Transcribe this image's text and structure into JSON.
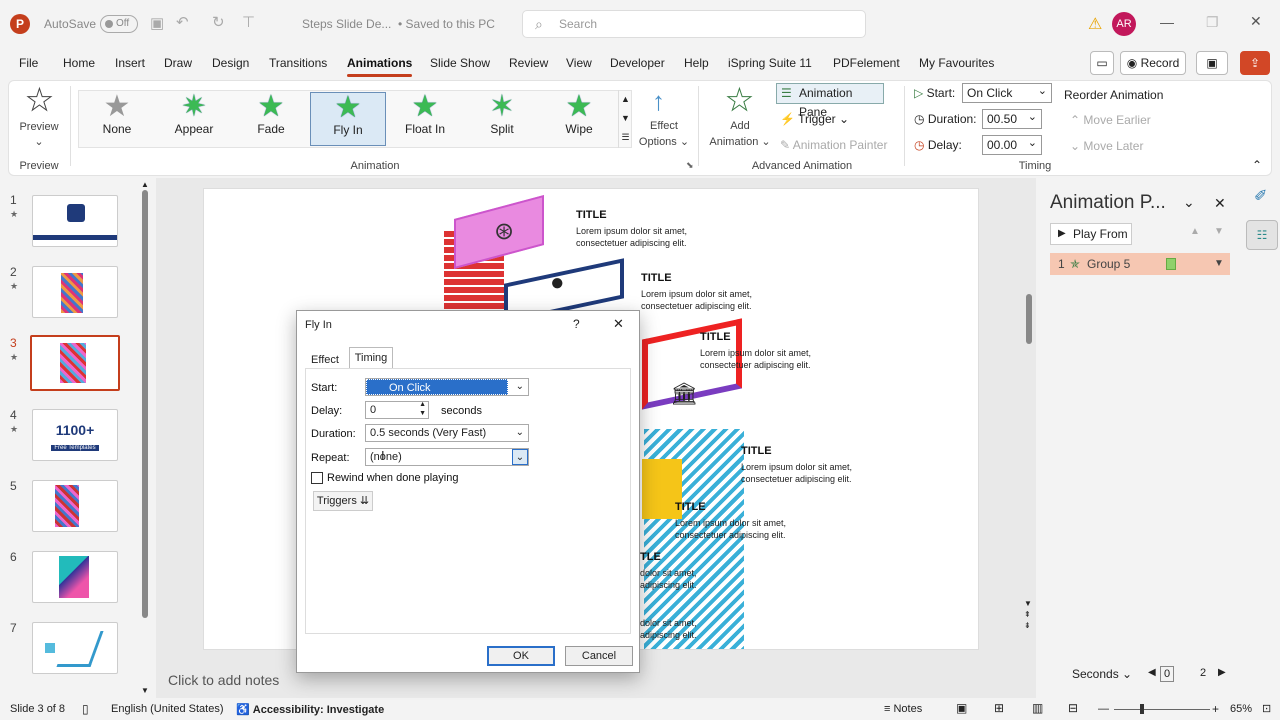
{
  "titlebar": {
    "autosave": "AutoSave",
    "toggle": "Off",
    "doc": "Steps Slide De...",
    "saved": "Saved to this PC",
    "search": "Search",
    "user": "AR"
  },
  "menu": [
    "File",
    "Home",
    "Insert",
    "Draw",
    "Design",
    "Transitions",
    "Animations",
    "Slide Show",
    "Review",
    "View",
    "Developer",
    "Help",
    "iSpring Suite 11",
    "PDFelement",
    "My Favourites"
  ],
  "record": "Record",
  "ribbon": {
    "preview": "Preview",
    "preview_group": "Preview",
    "gallery": [
      "None",
      "Appear",
      "Fade",
      "Fly In",
      "Float In",
      "Split",
      "Wipe"
    ],
    "animation_group": "Animation",
    "effect_options": "Effect",
    "effect_options2": "Options",
    "add_animation": "Add",
    "add_animation2": "Animation",
    "animation_pane": "Animation Pane",
    "trigger": "Trigger",
    "animation_painter": "Animation Painter",
    "advanced_group": "Advanced Animation",
    "start_label": "Start:",
    "start_value": "On Click",
    "duration_label": "Duration:",
    "duration_value": "00.50",
    "delay_label": "Delay:",
    "delay_value": "00.00",
    "reorder": "Reorder Animation",
    "move_earlier": "Move Earlier",
    "move_later": "Move Later",
    "timing_group": "Timing"
  },
  "slides": [
    "1",
    "2",
    "3",
    "4",
    "5",
    "6",
    "7"
  ],
  "thumb4_text": "1100+",
  "thumb4_sub": "Free Templates",
  "slide": {
    "title": "TITLE",
    "lorem1": "Lorem ipsum dolor sit amet,",
    "lorem2": "consectetuer adipiscing elit.",
    "partial_title": "TLE",
    "partial1": "dolor sit amet,",
    "partial2": "adipiscing elit."
  },
  "notes": "Click to add notes",
  "anim_pane": {
    "title": "Animation P...",
    "play_from": "Play From",
    "item_num": "1",
    "item_name": "Group 5",
    "seconds": "Seconds",
    "timeline_start": "0",
    "timeline_end": "2"
  },
  "dialog": {
    "title": "Fly In",
    "help": "?",
    "tab_effect": "Effect",
    "tab_timing": "Timing",
    "start_label": "Start:",
    "start_value": "On Click",
    "delay_label": "Delay:",
    "delay_value": "0",
    "delay_unit": "seconds",
    "duration_label": "Duration:",
    "duration_value": "0.5 seconds (Very Fast)",
    "repeat_label": "Repeat:",
    "repeat_value": "(none)",
    "rewind": "Rewind when done playing",
    "triggers": "Triggers",
    "ok": "OK",
    "cancel": "Cancel"
  },
  "status": {
    "slide": "Slide 3 of 8",
    "lang": "English (United States)",
    "access": "Accessibility: Investigate",
    "notes": "Notes",
    "zoom": "65%"
  }
}
